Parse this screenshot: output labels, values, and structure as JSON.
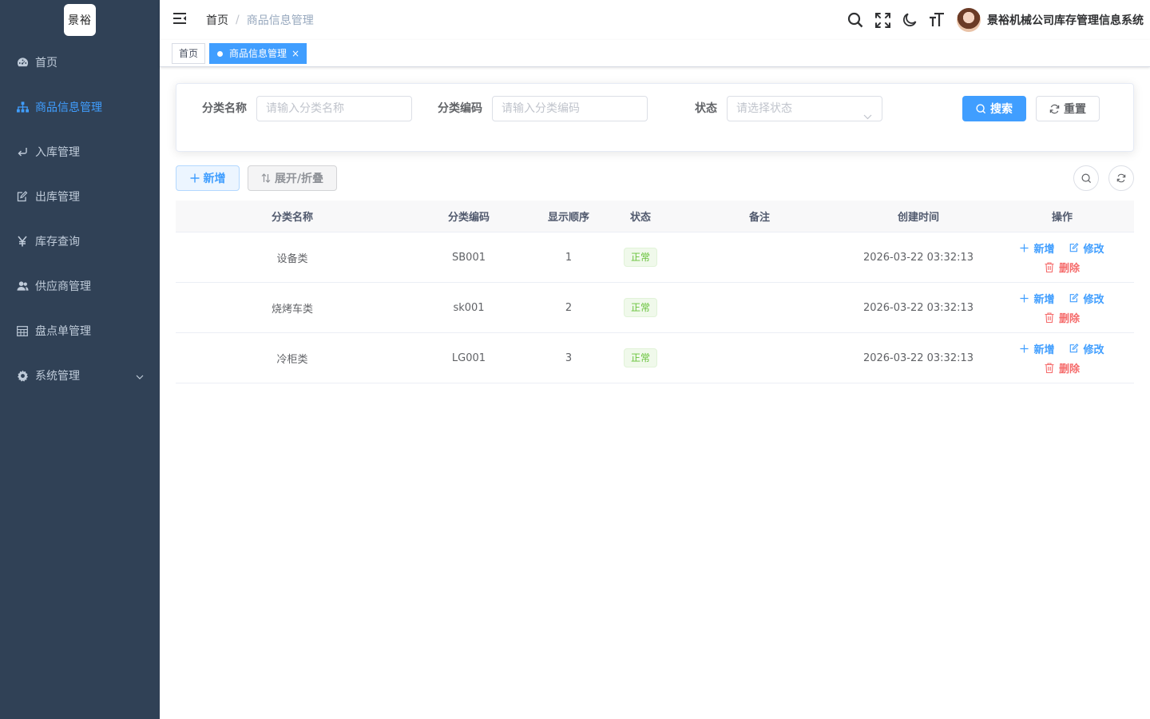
{
  "logo": {
    "text": "景裕"
  },
  "sidebar": {
    "items": [
      {
        "label": "首页",
        "icon": "dashboard-icon"
      },
      {
        "label": "商品信息管理",
        "icon": "tree-icon",
        "active": true
      },
      {
        "label": "入库管理",
        "icon": "enter-icon"
      },
      {
        "label": "出库管理",
        "icon": "edit-doc-icon"
      },
      {
        "label": "库存查询",
        "icon": "yen-icon"
      },
      {
        "label": "供应商管理",
        "icon": "people-icon"
      },
      {
        "label": "盘点单管理",
        "icon": "table-icon"
      },
      {
        "label": "系统管理",
        "icon": "gear-icon",
        "has_children": true
      }
    ]
  },
  "header": {
    "breadcrumb": {
      "home": "首页",
      "separator": "/",
      "current": "商品信息管理"
    },
    "app_title": "景裕机械公司库存管理信息系统"
  },
  "tags": {
    "home": "首页",
    "current": "商品信息管理",
    "close": "×"
  },
  "search": {
    "name_label": "分类名称",
    "name_placeholder": "请输入分类名称",
    "code_label": "分类编码",
    "code_placeholder": "请输入分类编码",
    "status_label": "状态",
    "status_placeholder": "请选择状态",
    "search_btn": "搜索",
    "reset_btn": "重置"
  },
  "toolbar": {
    "add_btn": "新增",
    "toggle_btn": "展开/折叠"
  },
  "table": {
    "columns": [
      "分类名称",
      "分类编码",
      "显示顺序",
      "状态",
      "备注",
      "创建时间",
      "操作"
    ],
    "rows": [
      {
        "name": "设备类",
        "code": "SB001",
        "order": "1",
        "status": "正常",
        "remark": "",
        "created": "2026-03-22 03:32:13"
      },
      {
        "name": "烧烤车类",
        "code": "sk001",
        "order": "2",
        "status": "正常",
        "remark": "",
        "created": "2026-03-22 03:32:13"
      },
      {
        "name": "冷柜类",
        "code": "LG001",
        "order": "3",
        "status": "正常",
        "remark": "",
        "created": "2026-03-22 03:32:13"
      }
    ],
    "ops": {
      "add": "新增",
      "edit": "修改",
      "delete": "删除"
    }
  },
  "colors": {
    "sidebar_bg": "#304156",
    "primary": "#409eff",
    "success": "#67c23a",
    "danger": "#f56c6c"
  }
}
